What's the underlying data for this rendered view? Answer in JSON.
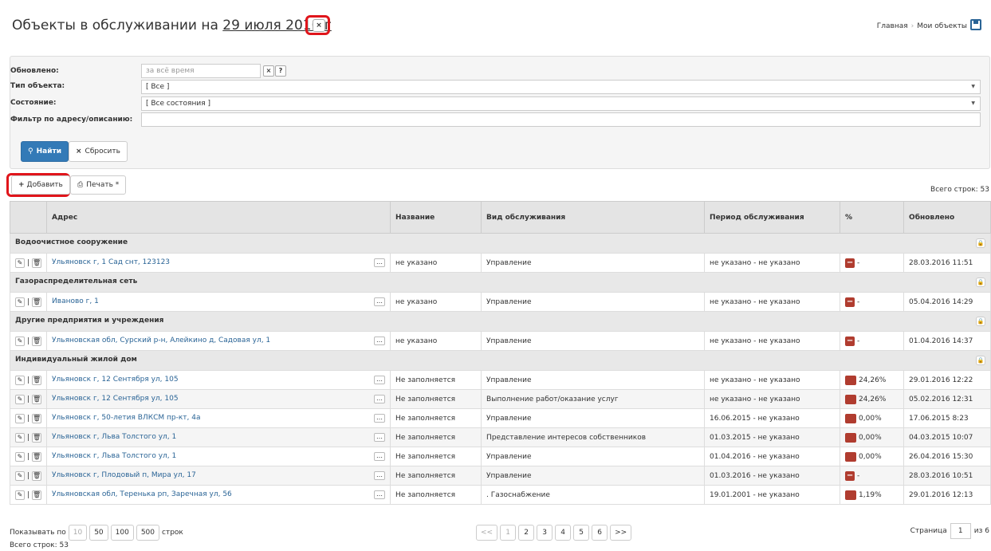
{
  "header": {
    "title_prefix": "Объекты в обслуживании на",
    "title_date": "29 июля 2016 г",
    "close_glyph": "×",
    "breadcrumb": [
      "Главная",
      "Мои объекты"
    ]
  },
  "filters": {
    "updated_label": "Обновлено:",
    "updated_placeholder": "за всё время",
    "type_label": "Тип объекта:",
    "type_value": "[ Все ]",
    "state_label": "Состояние:",
    "state_value": "[ Все состояния ]",
    "address_label": "Фильтр по адресу/описанию:",
    "address_value": "",
    "find_label": "Найти",
    "reset_label": "Сбросить"
  },
  "toolbar": {
    "add_label": "Добавить",
    "print_label": "Печать *",
    "total_top": "Всего строк: 53"
  },
  "table": {
    "columns": [
      "Адрес",
      "Название",
      "Вид обслуживания",
      "Период обслуживания",
      "%",
      "Обновлено"
    ],
    "groups": [
      {
        "name": "Водоочистное сооружение",
        "rows": [
          {
            "addr": "Ульяновск г, 1 Сад снт, 123123",
            "name": "не указано",
            "kind": "Управление",
            "period": "не указано - не указано",
            "pct": "-",
            "updated": "28.03.2016 11:51"
          }
        ]
      },
      {
        "name": "Газораспределительная сеть",
        "rows": [
          {
            "addr": "Иваново г, 1",
            "name": "не указано",
            "kind": "Управление",
            "period": "не указано - не указано",
            "pct": "-",
            "updated": "05.04.2016 14:29"
          }
        ]
      },
      {
        "name": "Другие предприятия и учреждения",
        "rows": [
          {
            "addr": "Ульяновская обл, Сурский р-н, Алейкино д, Садовая ул, 1",
            "name": "не указано",
            "kind": "Управление",
            "period": "не указано - не указано",
            "pct": "-",
            "updated": "01.04.2016 14:37"
          }
        ]
      },
      {
        "name": "Индивидуальный жилой дом",
        "rows": [
          {
            "addr": "Ульяновск г, 12 Сентября ул, 105",
            "name": "Не заполняется",
            "kind": "Управление",
            "period": "не указано - не указано",
            "pct": "24,26%",
            "updated": "29.01.2016 12:22"
          },
          {
            "addr": "Ульяновск г, 12 Сентября ул, 105",
            "name": "Не заполняется",
            "kind": "Выполнение работ/оказание услуг",
            "period": "не указано - не указано",
            "pct": "24,26%",
            "updated": "05.02.2016 12:31"
          },
          {
            "addr": "Ульяновск г, 50-летия ВЛКСМ пр-кт, 4а",
            "name": "Не заполняется",
            "kind": "Управление",
            "period": "16.06.2015 - не указано",
            "pct": "0,00%",
            "updated": "17.06.2015 8:23"
          },
          {
            "addr": "Ульяновск г, Льва Толстого ул, 1",
            "name": "Не заполняется",
            "kind": "Представление интересов собственников",
            "period": "01.03.2015 - не указано",
            "pct": "0,00%",
            "updated": "04.03.2015 10:07"
          },
          {
            "addr": "Ульяновск г, Льва Толстого ул, 1",
            "name": "Не заполняется",
            "kind": "Управление",
            "period": "01.04.2016 - не указано",
            "pct": "0,00%",
            "updated": "26.04.2016 15:30"
          },
          {
            "addr": "Ульяновск г, Плодовый п, Мира ул, 17",
            "name": "Не заполняется",
            "kind": "Управление",
            "period": "01.03.2016 - не указано",
            "pct": "-",
            "updated": "28.03.2016 10:51"
          },
          {
            "addr": "Ульяновская обл, Теренька рп, Заречная ул, 56",
            "name": "Не заполняется",
            "kind": ". Газоснабжение",
            "period": "19.01.2001 - не указано",
            "pct": "1,19%",
            "updated": "29.01.2016 12:13"
          }
        ]
      }
    ]
  },
  "pager": {
    "show_label": "Показывать по",
    "sizes": [
      "10",
      "50",
      "100",
      "500"
    ],
    "rows_word": "строк",
    "total_bottom": "Всего строк: 53",
    "pages": [
      "<<",
      "1",
      "2",
      "3",
      "4",
      "5",
      "6",
      ">>"
    ],
    "page_label": "Страница",
    "current_page": "1",
    "of_label": "из 6"
  }
}
